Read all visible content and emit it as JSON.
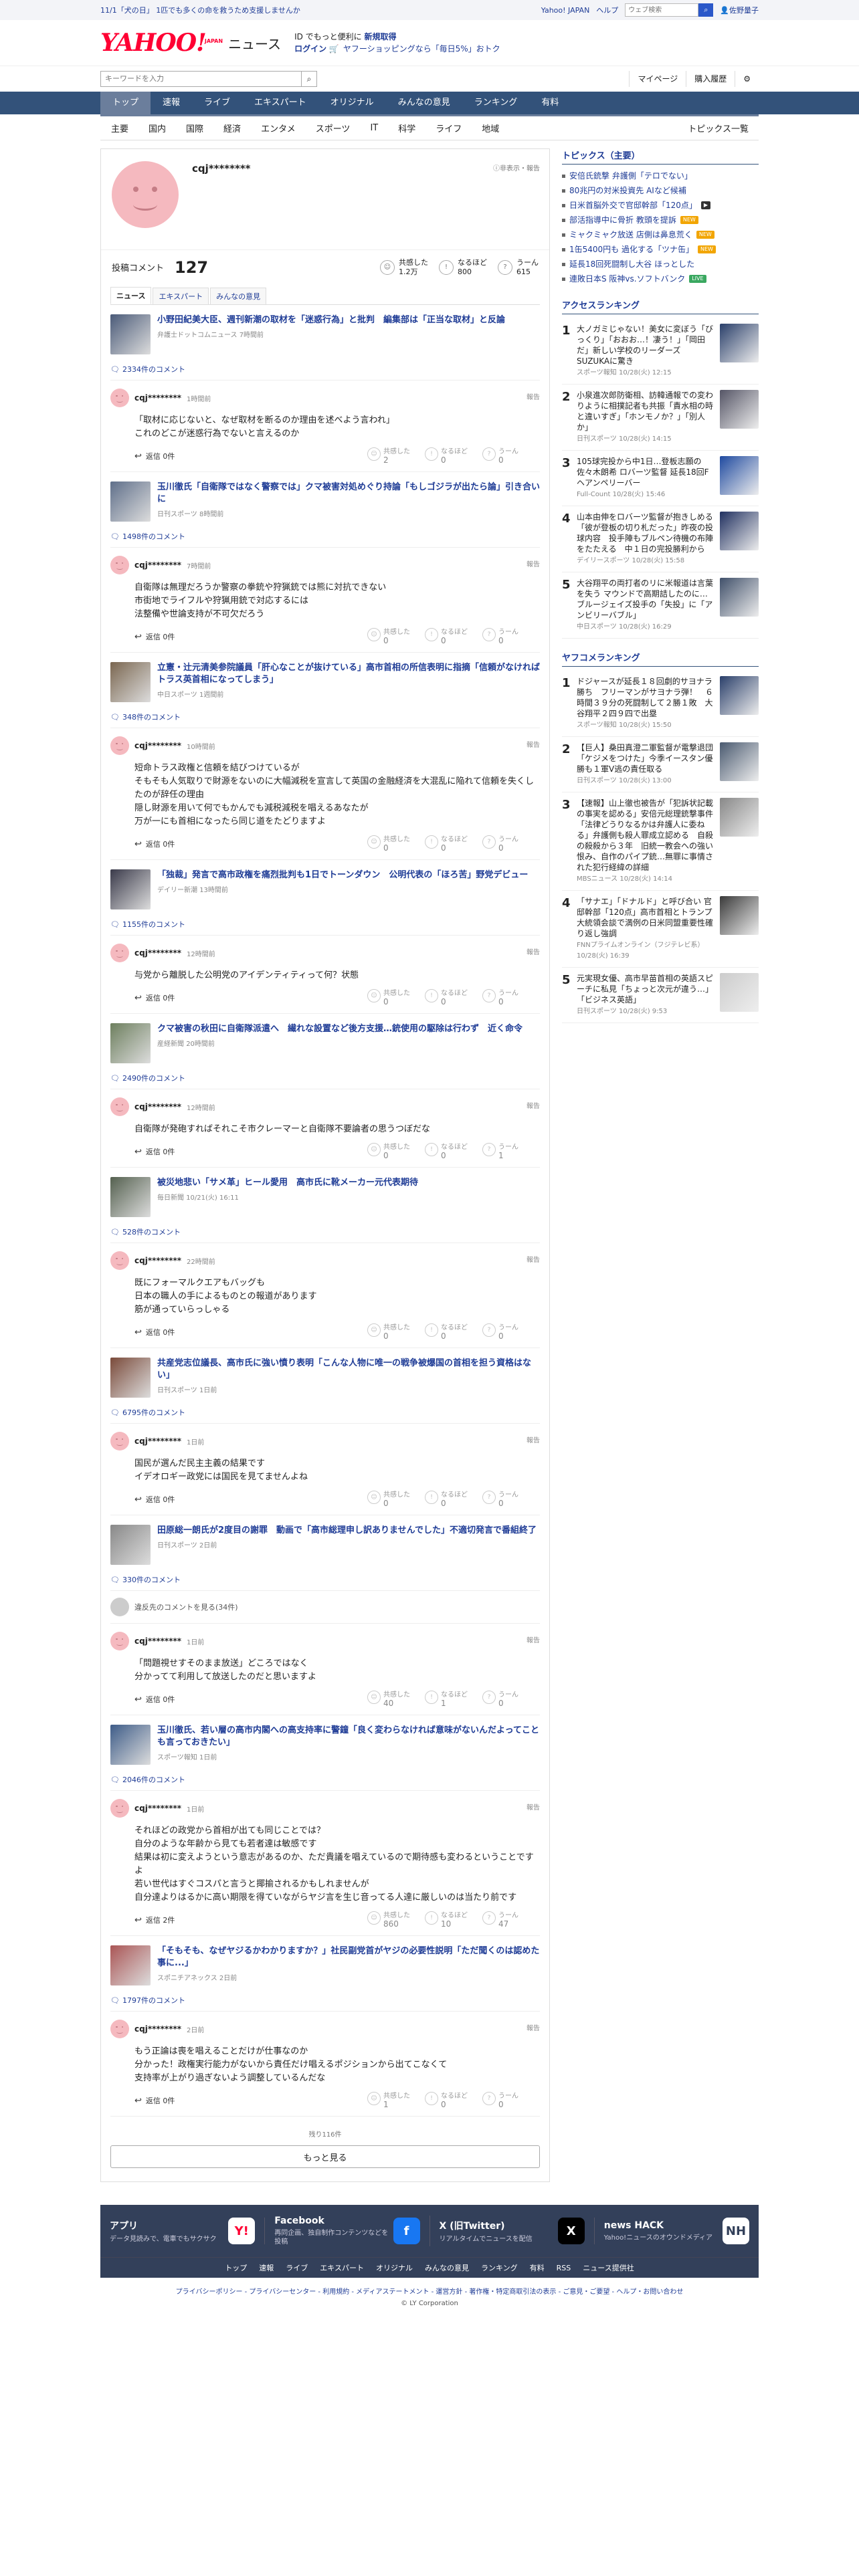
{
  "colors": {
    "brand_red": "#ff0033",
    "nav_blue": "#33527a",
    "link_blue": "#1f3c96",
    "footer_bg": "#33405a"
  },
  "topstrip": {
    "message": "11/1「犬の日」 1匹でも多くの命を救うため支援しませんか",
    "links": [
      "Yahoo! JAPAN",
      "ヘルプ"
    ],
    "search_placeholder": "ウェブ検索",
    "user": "佐野量子"
  },
  "header": {
    "logo_main": "YAHOO!",
    "logo_sub": "JAPAN",
    "logo_news": "ニュース",
    "promo_line1_a": "ID でもっと便利に",
    "promo_line1_b": "新規取得",
    "promo_login": "ログイン",
    "promo_line2": "ヤフーショッピングなら「毎日5%」おトク"
  },
  "search": {
    "placeholder": "キーワードを入力",
    "mypage": "マイページ",
    "history": "購入履歴"
  },
  "nav1": [
    "トップ",
    "速報",
    "ライブ",
    "エキスパート",
    "オリジナル",
    "みんなの意見",
    "ランキング",
    "有料"
  ],
  "nav2": [
    "主要",
    "国内",
    "国際",
    "経済",
    "エンタメ",
    "スポーツ",
    "IT",
    "科学",
    "ライフ",
    "地域"
  ],
  "nav2_right": "トピックス一覧",
  "profile": {
    "name": "cqj********",
    "report": "非表示・報告",
    "comment_label": "投稿コメント",
    "comment_count": "127",
    "stats": [
      {
        "label": "共感した",
        "value": "1.2万"
      },
      {
        "label": "なるほど",
        "value": "800"
      },
      {
        "label": "うーん",
        "value": "615"
      }
    ],
    "tabs": [
      "ニュース",
      "エキスパート",
      "みんなの意見"
    ]
  },
  "labels": {
    "reply": "返信",
    "report": "報告",
    "react1": "共感した",
    "react2": "なるほど",
    "react3": "うーん",
    "hidden": "違反先のコメントを見る(34件)"
  },
  "entries": [
    {
      "title": "小野田紀美大臣、週刊新潮の取材を「迷惑行為」と批判　編集部は「正当な取材」と反論",
      "source": "弁護士ドットコムニュース",
      "time": "7時間前",
      "comments": "2334件のコメント",
      "user": "cqj********",
      "ctime": "1時間前",
      "body": "「取材に応じないと、なぜ取材を断るのか理由を述べよう言われ」\nこれのどこが迷惑行為でないと言えるのか",
      "replies": "返信 0件",
      "r": [
        "2",
        "0",
        "0"
      ]
    },
    {
      "title": "玉川徹氏「自衛隊ではなく警察では」クマ被害対処めぐり持論「もしゴジラが出たら論」引き合いに",
      "source": "日刊スポーツ",
      "time": "8時間前",
      "comments": "1498件のコメント",
      "user": "cqj********",
      "ctime": "7時間前",
      "body": "自衛隊は無理だろうか警察の拳銃や狩猟銃では熊に対抗できない\n市街地でライフルや狩猟用銃で対応するには\n法整備や世論支持が不可欠だろう",
      "replies": "返信 0件",
      "r": [
        "0",
        "0",
        "0"
      ]
    },
    {
      "title": "立憲・辻元清美参院議員「肝心なことが抜けている」高市首相の所信表明に指摘「信頼がなければトラス英首相になってしまう」",
      "source": "中日スポーツ",
      "time": "1週間前",
      "comments": "348件のコメント",
      "user": "cqj********",
      "ctime": "10時間前",
      "body": "短命トラス政権と信頼を結びつけているが\nそもそも人気取りで財源をないのに大幅減税を宣言して英国の金融経済を大混乱に陥れて信頼を失くしたのが辞任の理由\n隠し財源を用いて何でもかんでも減税減税を唱えるあなたが\n万が一にも首相になったら同じ道をたどりますよ",
      "replies": "返信 0件",
      "r": [
        "0",
        "0",
        "0"
      ]
    },
    {
      "title": "「独裁」発言で高市政権を痛烈批判も1日でトーンダウン　公明代表の「ほろ苦」野党デビュー",
      "source": "デイリー新潮",
      "time": "13時間前",
      "comments": "1155件のコメント",
      "user": "cqj********",
      "ctime": "12時間前",
      "body": "与党から離脱した公明党のアイデンティティって何？状態",
      "replies": "返信 0件",
      "r": [
        "0",
        "0",
        "0"
      ]
    },
    {
      "title": "クマ被害の秋田に自衛隊派遣へ　繊れな設置など後方支援…銃使用の駆除は行わず　近く命令",
      "source": "産経新聞",
      "time": "20時間前",
      "comments": "2490件のコメント",
      "user": "cqj********",
      "ctime": "12時間前",
      "body": "自衛隊が発砲すればそれこそ市クレーマーと自衛隊不要論者の思うつぼだな",
      "replies": "返信 0件",
      "r": [
        "0",
        "0",
        "1"
      ]
    },
    {
      "title": "被災地悲い「サメ革」ヒール愛用　高市氏に靴メーカー元代表期待",
      "source": "毎日新聞",
      "time": "10/21(火) 16:11",
      "comments": "528件のコメント",
      "user": "cqj********",
      "ctime": "22時間前",
      "body": "既にフォーマルクエアもバッグも\n日本の職人の手によるものとの報道があります\n筋が通っていらっしゃる",
      "replies": "返信 0件",
      "r": [
        "0",
        "0",
        "0"
      ]
    },
    {
      "title": "共産党志位議長、高市氏に強い憤り表明「こんな人物に唯一の戦争被爆国の首相を担う資格はない」",
      "source": "日刊スポーツ",
      "time": "1日前",
      "comments": "6795件のコメント",
      "user": "cqj********",
      "ctime": "1日前",
      "body": "国民が選んだ民主主義の結果です\nイデオロギー政党には国民を見てませんよね",
      "replies": "返信 0件",
      "r": [
        "0",
        "0",
        "0"
      ]
    },
    {
      "title": "田原総一朗氏が2度目の謝罪　動画で「高市総理申し訳ありませんでした」不適切発言で番組終了",
      "source": "日刊スポーツ",
      "time": "2日前",
      "comments": "330件のコメント",
      "hidden": true,
      "user": "cqj********",
      "ctime": "1日前",
      "body": "「問題視せすそのまま放送」どころではなく\n分かってて利用して放送したのだと思いますよ",
      "replies": "返信 0件",
      "r": [
        "40",
        "1",
        "0"
      ]
    },
    {
      "title": "玉川徹氏、若い層の高市内閣への高支持率に警鐘「良く変わらなければ意味がないんだよってことも言っておきたい」",
      "source": "スポーツ報知",
      "time": "1日前",
      "comments": "2046件のコメント",
      "user": "cqj********",
      "ctime": "1日前",
      "body": "それほどの政党から首相が出ても同じことでは？\n自分のような年齢から見ても若者達は敏感です\n結果は初に変えようという意志があるのか、ただ貴議を唱えているので期待感も変わるということですよ\n若い世代はすぐコスパと言うと揶揄されるかもしれませんが\n自分達よりはるかに高い期限を得ていながらヤジ言を生じ音ってる人達に厳しいのは当たり前です",
      "replies": "返信 2件",
      "r": [
        "860",
        "10",
        "47"
      ]
    },
    {
      "title": "「そもそも、なぜヤジるかわかりますか？」社民副党首がヤジの必要性説明「ただ聞くのは認めた事に...」",
      "source": "スポニチアネックス",
      "time": "2日前",
      "comments": "1797件のコメント",
      "user": "cqj********",
      "ctime": "2日前",
      "body": "もう正論は喪を唱えることだけが仕事なのか\n分かった！政権実行能力がないから責任だけ唱えるポジションから出てこなくて\n支持率が上がり過ぎないよう調整しているんだな",
      "replies": "返信 0件",
      "r": [
        "1",
        "0",
        "0"
      ]
    }
  ],
  "remaining": "残り116件",
  "more": "もっと見る",
  "topics": {
    "heading": "トピックス（主要）",
    "items": [
      {
        "text": "安倍氏銃撃 弁護側「テロでない」",
        "badge": ""
      },
      {
        "text": "80兆円の対米投資先 AIなど候補",
        "badge": ""
      },
      {
        "text": "日米首脳外交で官邸幹部「120点」",
        "badge": "video"
      },
      {
        "text": "部活指導中に骨折 教頭を提訴",
        "badge": "new"
      },
      {
        "text": "ミャクミャク放送 店側は鼻息荒く",
        "badge": "new"
      },
      {
        "text": "1缶5400円も 過化する「ツナ缶」",
        "badge": "new"
      },
      {
        "text": "延長18回死闘制し大谷 ほっとした",
        "badge": ""
      },
      {
        "text": "連敗日本S 阪神vs.ソフトバンク",
        "badge": "live"
      }
    ]
  },
  "access": {
    "heading": "アクセスランキング",
    "items": [
      {
        "n": "1",
        "text": "大ノガミじゃない！美女に変ぼう「びっくり」「おおお…！凄う！」「岡田だ」新しい学校のリーダーズ SUZUKAに驚き",
        "src": "スポーツ報知 10/28(火) 12:15"
      },
      {
        "n": "2",
        "text": "小泉進次郎防衛相、訪韓通報での変わりように相撲記者も共振「責水相の時と違いすぎ」「ホンモノか？」「別人か」",
        "src": "日刊スポーツ 10/28(火) 14:15"
      },
      {
        "n": "3",
        "text": "105球完投から中1日…登板志願の佐々木朗希 ロバーツ監督 延長18回Fヘアンペリーバー",
        "src": "Full-Count 10/28(火) 15:46"
      },
      {
        "n": "4",
        "text": "山本由伸をロバーツ監督が抱きしめる「彼が登板の切り札だった」昨夜の投球内容　投手陣もブルペン待機の布陣をたたえる　中１日の完投勝利から",
        "src": "デイリースポーツ 10/28(火) 15:58"
      },
      {
        "n": "5",
        "text": "大谷翔平の両打者のリに米報道は言葉を失う マウンドで高期詰したのに…ブルージェイズ投手の「失投」に「アンビリーバブル」",
        "src": "中日スポーツ 10/28(火) 16:29"
      }
    ]
  },
  "yahoo_rank": {
    "heading": "ヤフコメランキング",
    "items": [
      {
        "n": "1",
        "text": "ドジャースが延長１８回劇的サヨナラ勝ち　フリーマンがサヨナラ弾！　６時間３９分の死闘制して２勝１敗　大谷翔平２四９四で出塁",
        "src": "スポーツ報知 10/28(火) 15:50"
      },
      {
        "n": "2",
        "text": "【巨人】桑田真澄二軍監督が電撃退団「ケジメをつけた」今季イースタン優勝も１軍V逃の責任取る",
        "src": "日刊スポーツ 10/28(火) 13:00"
      },
      {
        "n": "3",
        "text": "【速報】山上徹也被告が「犯訴状記載の事実を認める」安倍元総理銃撃事件「法律どうりなるかは弁護人に委ねる」弁護側も殺人罪成立認める　自殺の殺殺から３年　旧統一教会への強い恨み、自作のパイプ銃…無罪に事情された犯行経緯の詳細",
        "src": "MBSニュース 10/28(火) 14:14"
      },
      {
        "n": "4",
        "text": "「サナエ」「ドナルド」と呼び合い 官邸幹部「120点」高市首相とトランプ大統領会談で満例の日米同盟重要性確り返し強調",
        "src": "FNNプライムオンライン（フジテレビ系） 10/28(火) 16:39"
      },
      {
        "n": "5",
        "text": "元実現女優、高市早苗首相の英語スピーチに私見「ちょっと次元が違う…」「ビジネス英語」",
        "src": "日刊スポーツ 10/28(火) 9:53"
      }
    ]
  },
  "footer": {
    "apps": [
      {
        "title": "アプリ",
        "desc": "データ見読みで、電車でもサクサク",
        "icon": "yahoo-app-icon"
      },
      {
        "title": "Facebook",
        "desc": "再同企画、独自制作コンテンツなどを投稿",
        "icon": "facebook-icon"
      },
      {
        "title": "X (旧Twitter)",
        "desc": "リアルタイムでニュースを配信",
        "icon": "x-icon"
      },
      {
        "title": "news HACK",
        "desc": "Yahoo!ニュースのオウンドメディア",
        "icon": "newshack-icon"
      }
    ],
    "nav": [
      "トップ",
      "速報",
      "ライブ",
      "エキスパート",
      "オリジナル",
      "みんなの意見",
      "ランキング",
      "有料",
      "RSS",
      "ニュース提供社"
    ],
    "links": "プライバシーポリシー - プライバシーセンター - 利用規約 - メディアステートメント - 運営方針 - 著作権・特定商取引法の表示 - ご意見・ご要望 - ヘルプ・お問い合わせ",
    "copyright": "© LY Corporation"
  }
}
